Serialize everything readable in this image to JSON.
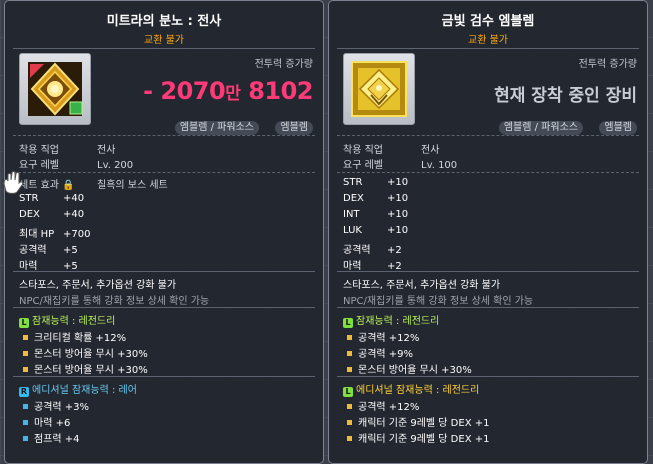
{
  "left": {
    "title": "미트라의 분노 : 전사",
    "trade": "교환 불가",
    "cp_label": "전투력 증가량",
    "cp_value": "- 2070",
    "cp_unit_man": "만",
    "cp_value_rest": " 8102",
    "tags": [
      "엠블렘 / 파워소스",
      "엠블렘"
    ],
    "req_job_label": "착용 직업",
    "req_job": "전사",
    "req_level_label": "요구 레벨",
    "req_level": "Lv. 200",
    "set_label": "세트 효과",
    "set_name": "칠흑의 보스 세트",
    "stats": [
      {
        "k": "STR",
        "v": "+40"
      },
      {
        "k": "DEX",
        "v": "+40"
      },
      {
        "k": "최대 HP",
        "v": "+700"
      },
      {
        "k": "공격력",
        "v": "+5"
      },
      {
        "k": "마력",
        "v": "+5"
      }
    ],
    "enhance": "스타포스, 주문서, 추가옵션 강화 불가",
    "enhance_note": "NPC/재집키를 통해 강화 정보 상세 확인 가능",
    "potential_title": "잠재능력 : 레전드리",
    "potential": [
      "크리티컬 확률 +12%",
      "몬스터 방어율 무시 +30%",
      "몬스터 방어율 무시 +30%"
    ],
    "additional_title": "에디셔널 잠재능력 : 레어",
    "additional": [
      "공격력 +3%",
      "마력 +6",
      "점프력 +4"
    ]
  },
  "right": {
    "title": "금빛 검수 엠블렘",
    "trade": "교환 불가",
    "cp_label": "전투력 증가량",
    "cp_text": "현재 장착 중인 장비",
    "tags": [
      "엠블렘 / 파워소스",
      "엠블렘"
    ],
    "req_job_label": "착용 직업",
    "req_job": "전사",
    "req_level_label": "요구 레벨",
    "req_level": "Lv. 100",
    "stats": [
      {
        "k": "STR",
        "v": "+10"
      },
      {
        "k": "DEX",
        "v": "+10"
      },
      {
        "k": "INT",
        "v": "+10"
      },
      {
        "k": "LUK",
        "v": "+10"
      },
      {
        "k": "공격력",
        "v": "+2"
      },
      {
        "k": "마력",
        "v": "+2"
      }
    ],
    "enhance": "스타포스, 주문서, 추가옵션 강화 불가",
    "enhance_note": "NPC/재집키를 통해 강화 정보 상세 확인 가능",
    "potential_title": "잠재능력 : 레전드리",
    "potential": [
      "공격력 +12%",
      "공격력 +9%",
      "몬스터 방어율 무시 +30%"
    ],
    "additional_title": "에디셔널 잠재능력 : 레전드리",
    "additional": [
      "공격력 +12%",
      "캐릭터 기준 9레벨 당 DEX +1",
      "캐릭터 기준 9레벨 당 DEX +1"
    ]
  },
  "colors": {
    "cp_negative": "#ff3a78",
    "trade_orange": "#ffaa11",
    "legendary_green": "#7fe042",
    "rare_blue": "#36b8f0",
    "legendary_text": "#b9f35a",
    "rare_text": "#68c8f2",
    "legendary_additional_text": "#ffd23a"
  },
  "icons": {
    "left_item": "golden-emblem-with-red-gem-icon",
    "right_item": "golden-ornate-emblem-icon",
    "cursor": "white-glove-cursor-icon"
  }
}
